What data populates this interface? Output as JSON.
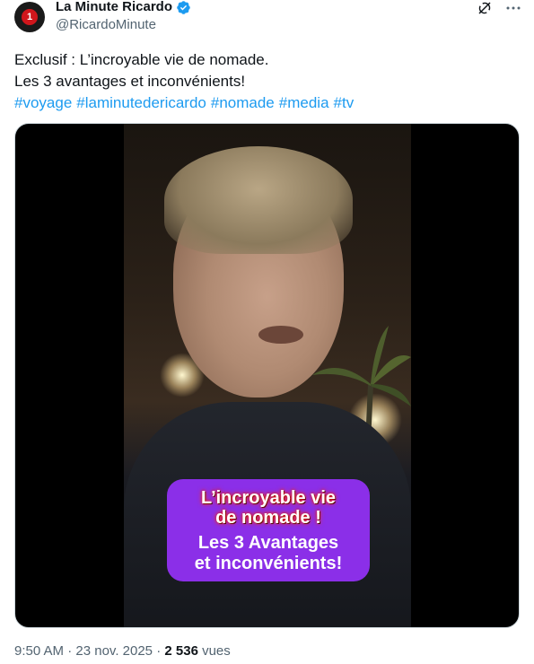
{
  "author": {
    "display_name": "La Minute Ricardo",
    "handle": "@RicardoMinute",
    "avatar_text": "1",
    "verified_icon": "verified-badge-icon"
  },
  "actions": {
    "grok_icon": "grok-icon",
    "more_icon": "more-icon"
  },
  "tweet": {
    "line1": "Exclusif : L’incroyable vie de nomade.",
    "line2": "Les 3 avantages et inconvénients!",
    "hashtags": [
      "#voyage",
      "#laminutedericardo",
      "#nomade",
      "#media",
      "#tv"
    ]
  },
  "video": {
    "caption_line1": "L’incroyable vie",
    "caption_line2": "de nomade !",
    "caption_line3": "Les 3 Avantages",
    "caption_line4": "et inconvénients!"
  },
  "footer": {
    "time": "9:50 AM",
    "sep1": " · ",
    "date": "23 nov. 2025",
    "sep2": " · ",
    "views_count": "2 536",
    "views_label": " vues"
  },
  "colors": {
    "link": "#1d9bf0",
    "muted": "#536471",
    "caption_bg": "#8b2fe8"
  }
}
